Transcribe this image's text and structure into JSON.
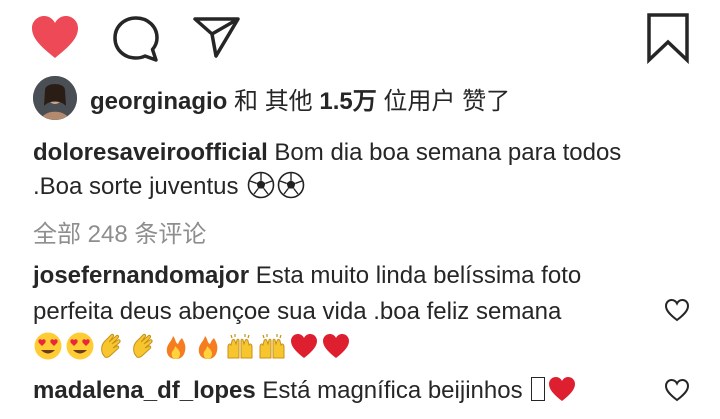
{
  "actions": {
    "like_icon": "heart-filled-icon",
    "comment_icon": "speech-bubble-icon",
    "share_icon": "paper-plane-icon",
    "save_icon": "bookmark-icon",
    "like_color": "#ed4956"
  },
  "likes": {
    "username": "georginagio",
    "suffix_and": "和",
    "suffix_others": "其他",
    "count": "1.5万",
    "suffix_users_liked": "位用户 赞了"
  },
  "caption": {
    "username": "doloresaveiroofficial",
    "text": "Bom dia boa semana para todos .Boa sorte juventus"
  },
  "view_all_comments": "全部 248 条评论",
  "comments": [
    {
      "username": "josefernandomajor",
      "text": "Esta muito linda belíssima foto perfeita deus abençoe sua vida .boa feliz semana"
    },
    {
      "username": "madalena_df_lopes",
      "text": "Está magnífica beijinhos"
    }
  ]
}
